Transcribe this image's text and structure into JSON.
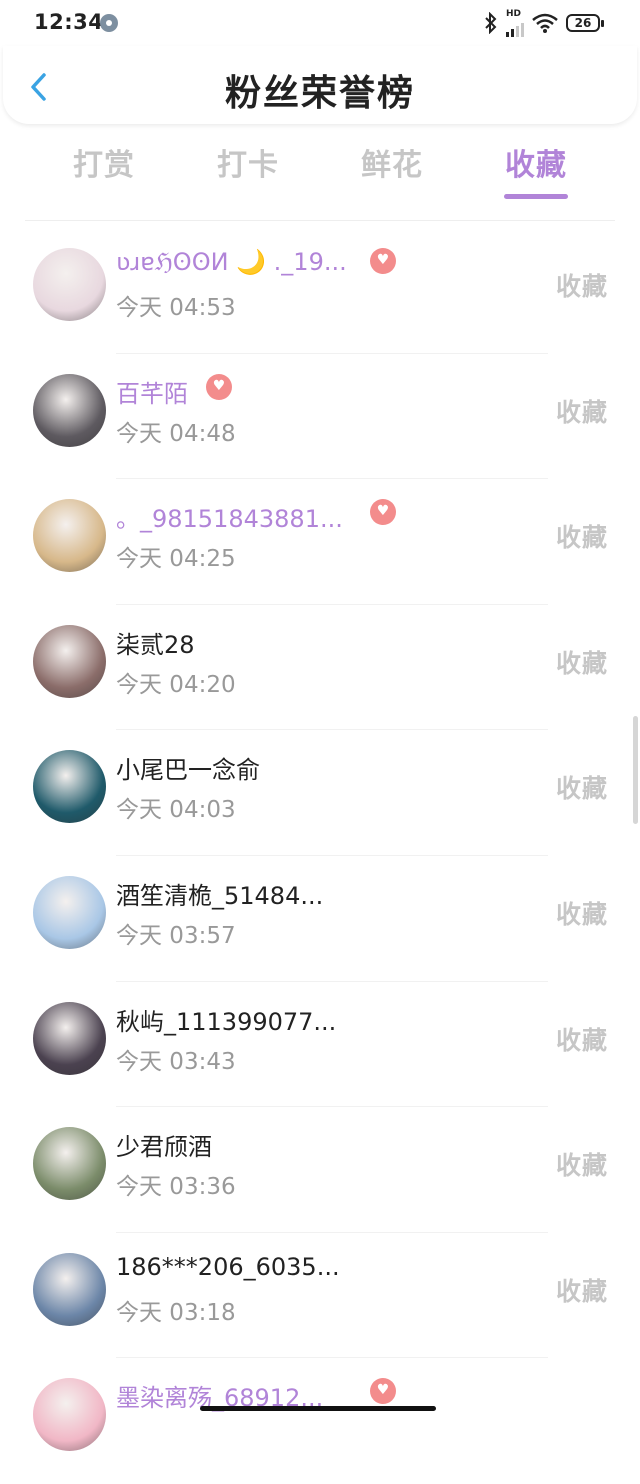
{
  "status_bar": {
    "time": "12:34",
    "network_label": "HD",
    "battery": "26"
  },
  "header": {
    "title": "粉丝荣誉榜"
  },
  "tabs": [
    {
      "label": "打赏"
    },
    {
      "label": "打卡"
    },
    {
      "label": "鲜花"
    },
    {
      "label": "收藏",
      "active": true
    }
  ],
  "list": [
    {
      "name": "ʋɹɐℌʘʘИ 🌙 ._19...",
      "time": "今天 04:53",
      "action": "收藏",
      "vip": true,
      "avatar_color": "#e8d8df"
    },
    {
      "name": "百芊陌",
      "time": "今天 04:48",
      "action": "收藏",
      "vip": true,
      "avatar_color": "#5e5a60"
    },
    {
      "name": "。_98151843881...",
      "time": "今天 04:25",
      "action": "收藏",
      "vip": true,
      "avatar_color": "#d7b88a"
    },
    {
      "name": "柒贰28",
      "time": "今天 04:20",
      "action": "收藏",
      "vip": false,
      "avatar_color": "#8b6d6a"
    },
    {
      "name": "小尾巴一念俞",
      "time": "今天 04:03",
      "action": "收藏",
      "vip": false,
      "avatar_color": "#1f5a6a"
    },
    {
      "name": "酒笙清桅_51484...",
      "time": "今天 03:57",
      "action": "收藏",
      "vip": false,
      "avatar_color": "#a9c7e6"
    },
    {
      "name": "秋屿_111399077...",
      "time": "今天 03:43",
      "action": "收藏",
      "vip": false,
      "avatar_color": "#4b4250"
    },
    {
      "name": "少君颀酒",
      "time": "今天 03:36",
      "action": "收藏",
      "vip": false,
      "avatar_color": "#7b8c6a"
    },
    {
      "name": "186***206_6035...",
      "time": "今天 03:18",
      "action": "收藏",
      "vip": false,
      "avatar_color": "#6c86a8"
    },
    {
      "name": "墨染离殇_68912...",
      "time": "",
      "action": "",
      "vip": true,
      "avatar_color": "#f1b7c6"
    }
  ],
  "icons": {
    "back": "chevron-left-icon",
    "settings": "gear-icon",
    "bluetooth": "bluetooth-icon",
    "wifi": "wifi-icon",
    "vip": "vip-badge-icon"
  },
  "colors": {
    "accent": "#b184d8",
    "vip_badge": "#f38c8c",
    "back_arrow": "#3aa3e3",
    "muted": "#c6c6c6"
  }
}
